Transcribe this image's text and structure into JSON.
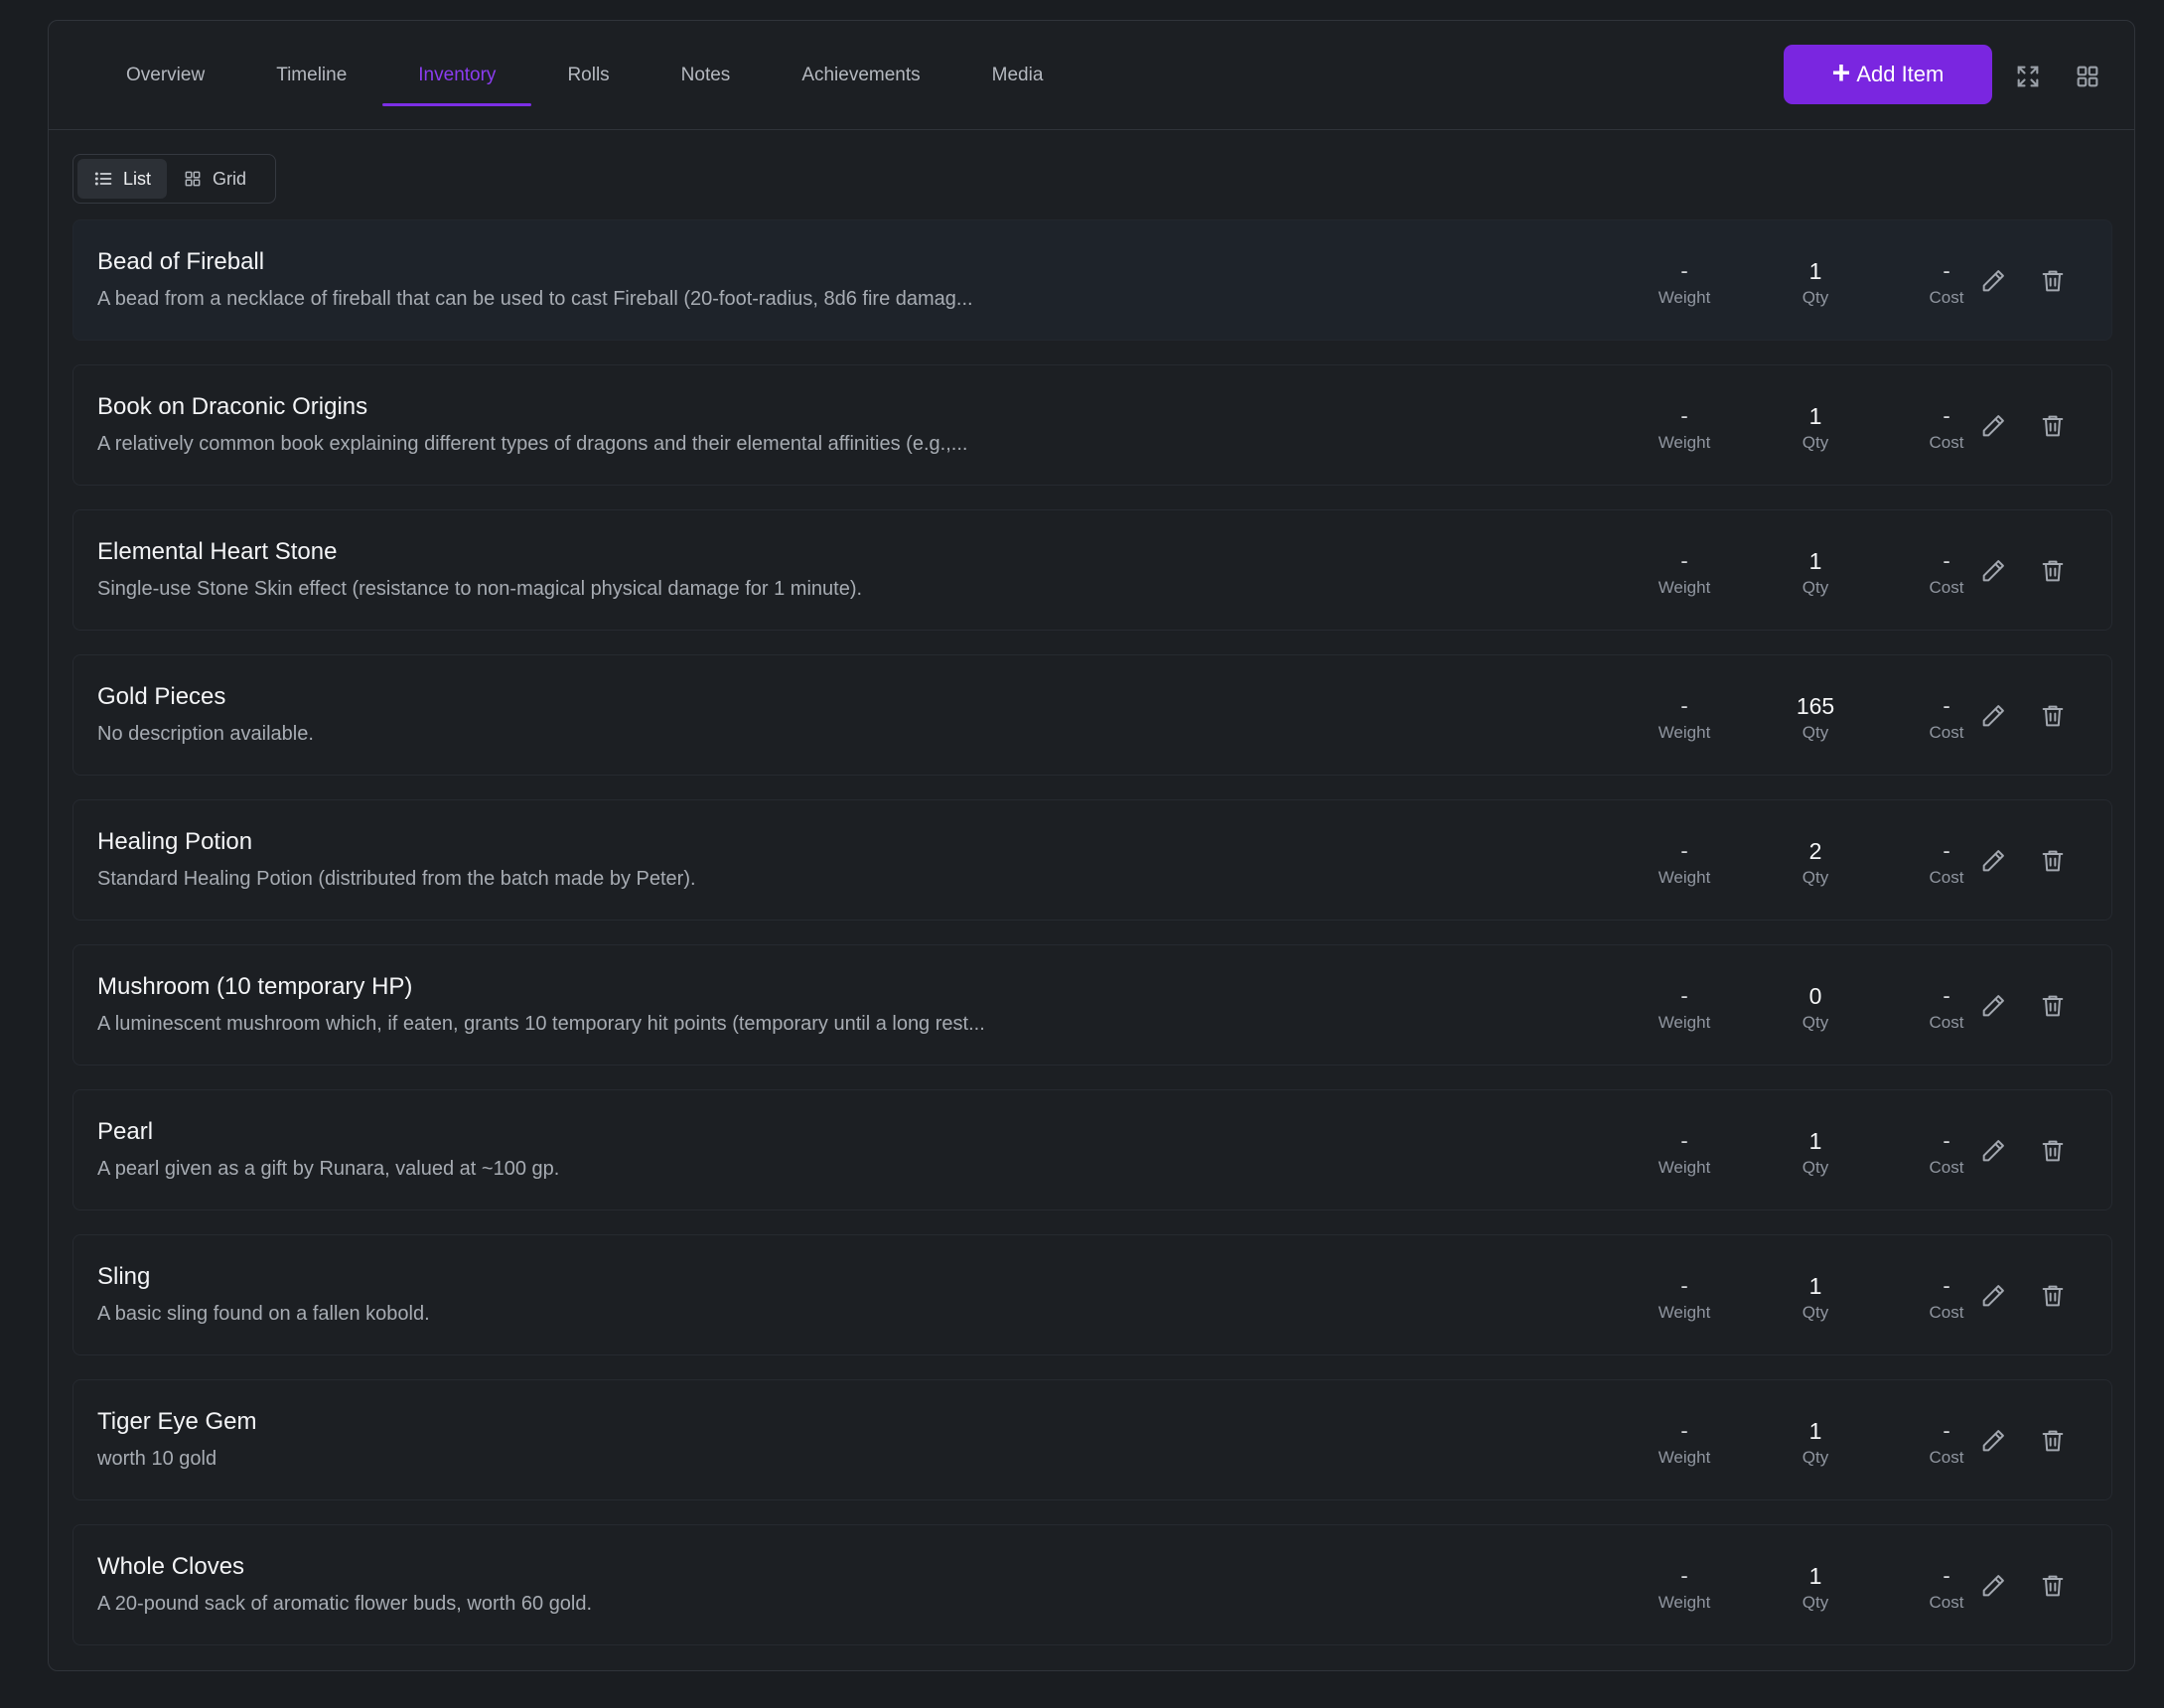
{
  "tabs": [
    {
      "label": "Overview"
    },
    {
      "label": "Timeline"
    },
    {
      "label": "Inventory"
    },
    {
      "label": "Rolls"
    },
    {
      "label": "Notes"
    },
    {
      "label": "Achievements"
    },
    {
      "label": "Media"
    }
  ],
  "active_tab": "Inventory",
  "toolbar": {
    "add_label": "Add Item",
    "add_icon": "plus-icon",
    "expand_icon": "expand-icon",
    "layout_icon": "grid-icon"
  },
  "view_toggle": {
    "list_label": "List",
    "grid_label": "Grid",
    "selected": "List"
  },
  "stat_labels": {
    "weight": "Weight",
    "qty": "Qty",
    "cost": "Cost"
  },
  "colors": {
    "accent": "#7a26e0",
    "active_tab": "#8b3cf0",
    "background": "#1a1d21"
  },
  "items": [
    {
      "name": "Bead of Fireball",
      "description": "A bead from a necklace of fireball that can be used to cast Fireball (20-foot-radius, 8d6 fire damag...",
      "weight": "-",
      "qty": "1",
      "cost": "-"
    },
    {
      "name": "Book on Draconic Origins",
      "description": "A relatively common book explaining different types of dragons and their elemental affinities (e.g.,...",
      "weight": "-",
      "qty": "1",
      "cost": "-"
    },
    {
      "name": "Elemental Heart Stone",
      "description": "Single-use Stone Skin effect (resistance to non-magical physical damage for 1 minute).",
      "weight": "-",
      "qty": "1",
      "cost": "-"
    },
    {
      "name": "Gold Pieces",
      "description": "No description available.",
      "weight": "-",
      "qty": "165",
      "cost": "-"
    },
    {
      "name": "Healing Potion",
      "description": "Standard Healing Potion (distributed from the batch made by Peter).",
      "weight": "-",
      "qty": "2",
      "cost": "-"
    },
    {
      "name": "Mushroom (10 temporary HP)",
      "description": "A luminescent mushroom which, if eaten, grants 10 temporary hit points (temporary until a long rest...",
      "weight": "-",
      "qty": "0",
      "cost": "-"
    },
    {
      "name": "Pearl",
      "description": "A pearl given as a gift by Runara, valued at ~100 gp.",
      "weight": "-",
      "qty": "1",
      "cost": "-"
    },
    {
      "name": "Sling",
      "description": "A basic sling found on a fallen kobold.",
      "weight": "-",
      "qty": "1",
      "cost": "-"
    },
    {
      "name": "Tiger Eye Gem",
      "description": "worth 10 gold",
      "weight": "-",
      "qty": "1",
      "cost": "-"
    },
    {
      "name": "Whole Cloves",
      "description": "A 20-pound sack of aromatic flower buds, worth 60 gold.",
      "weight": "-",
      "qty": "1",
      "cost": "-"
    }
  ]
}
